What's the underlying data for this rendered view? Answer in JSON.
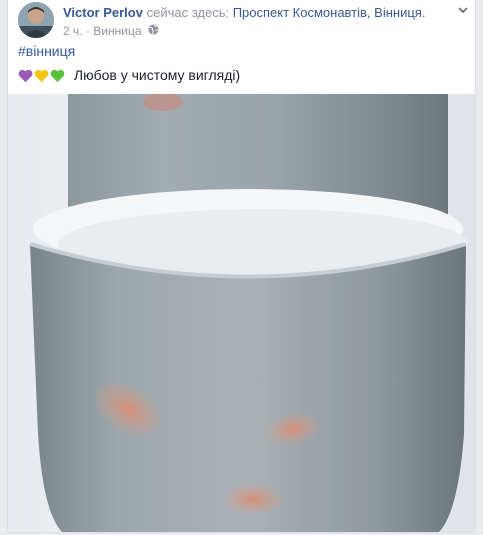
{
  "post": {
    "author": "Victor Perlov",
    "action": "сейчас здесь:",
    "place": "Проспект Космонавтів, Вінниця.",
    "time": "2 ч.",
    "separator": "·",
    "city": "Винница",
    "hashtag": "#вінниця",
    "text": "Любов у чистому вигляді)",
    "emoji_icons": [
      "purple-heart-icon",
      "yellow-heart-icon",
      "green-heart-icon"
    ],
    "heart_colors": [
      "#9b59b6",
      "#f5c518",
      "#5bbf3a"
    ],
    "link_color": "#365899",
    "meta_color": "#90949c"
  }
}
